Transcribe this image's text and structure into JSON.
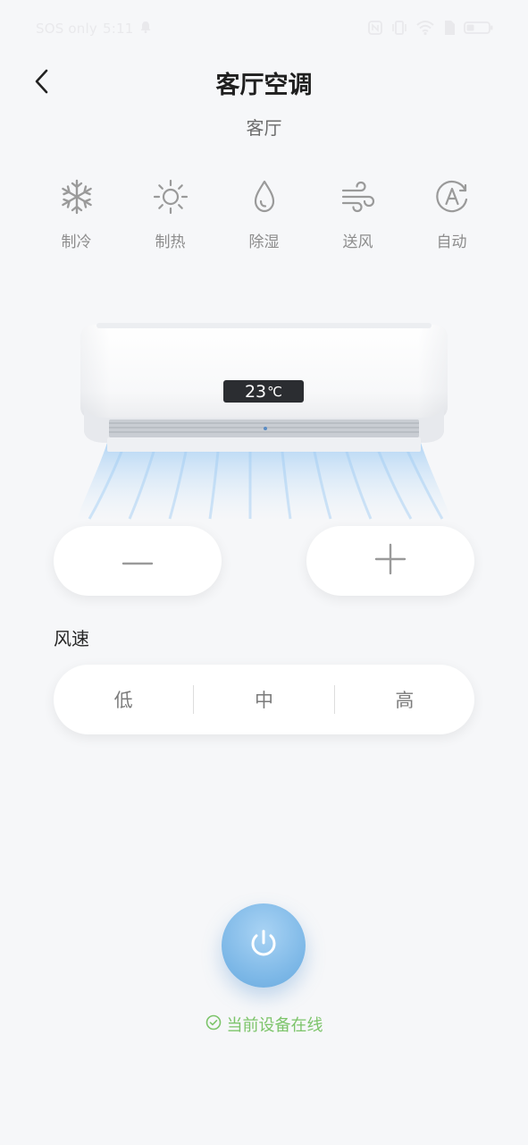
{
  "status_bar": {
    "carrier": "SOS only",
    "time": "5:11"
  },
  "header": {
    "title": "客厅空调",
    "subtitle": "客厅"
  },
  "modes": [
    {
      "label": "制冷",
      "icon": "snowflake-icon"
    },
    {
      "label": "制热",
      "icon": "sun-icon"
    },
    {
      "label": "除湿",
      "icon": "droplet-icon"
    },
    {
      "label": "送风",
      "icon": "wind-icon"
    },
    {
      "label": "自动",
      "icon": "auto-icon"
    }
  ],
  "ac_display": {
    "temperature": "23",
    "unit": "℃"
  },
  "fan": {
    "title": "风速",
    "options": [
      "低",
      "中",
      "高"
    ]
  },
  "status": {
    "online_text": "当前设备在线"
  },
  "colors": {
    "background": "#f6f7f9",
    "accent": "#7ab6e6",
    "online": "#7cc46a"
  }
}
